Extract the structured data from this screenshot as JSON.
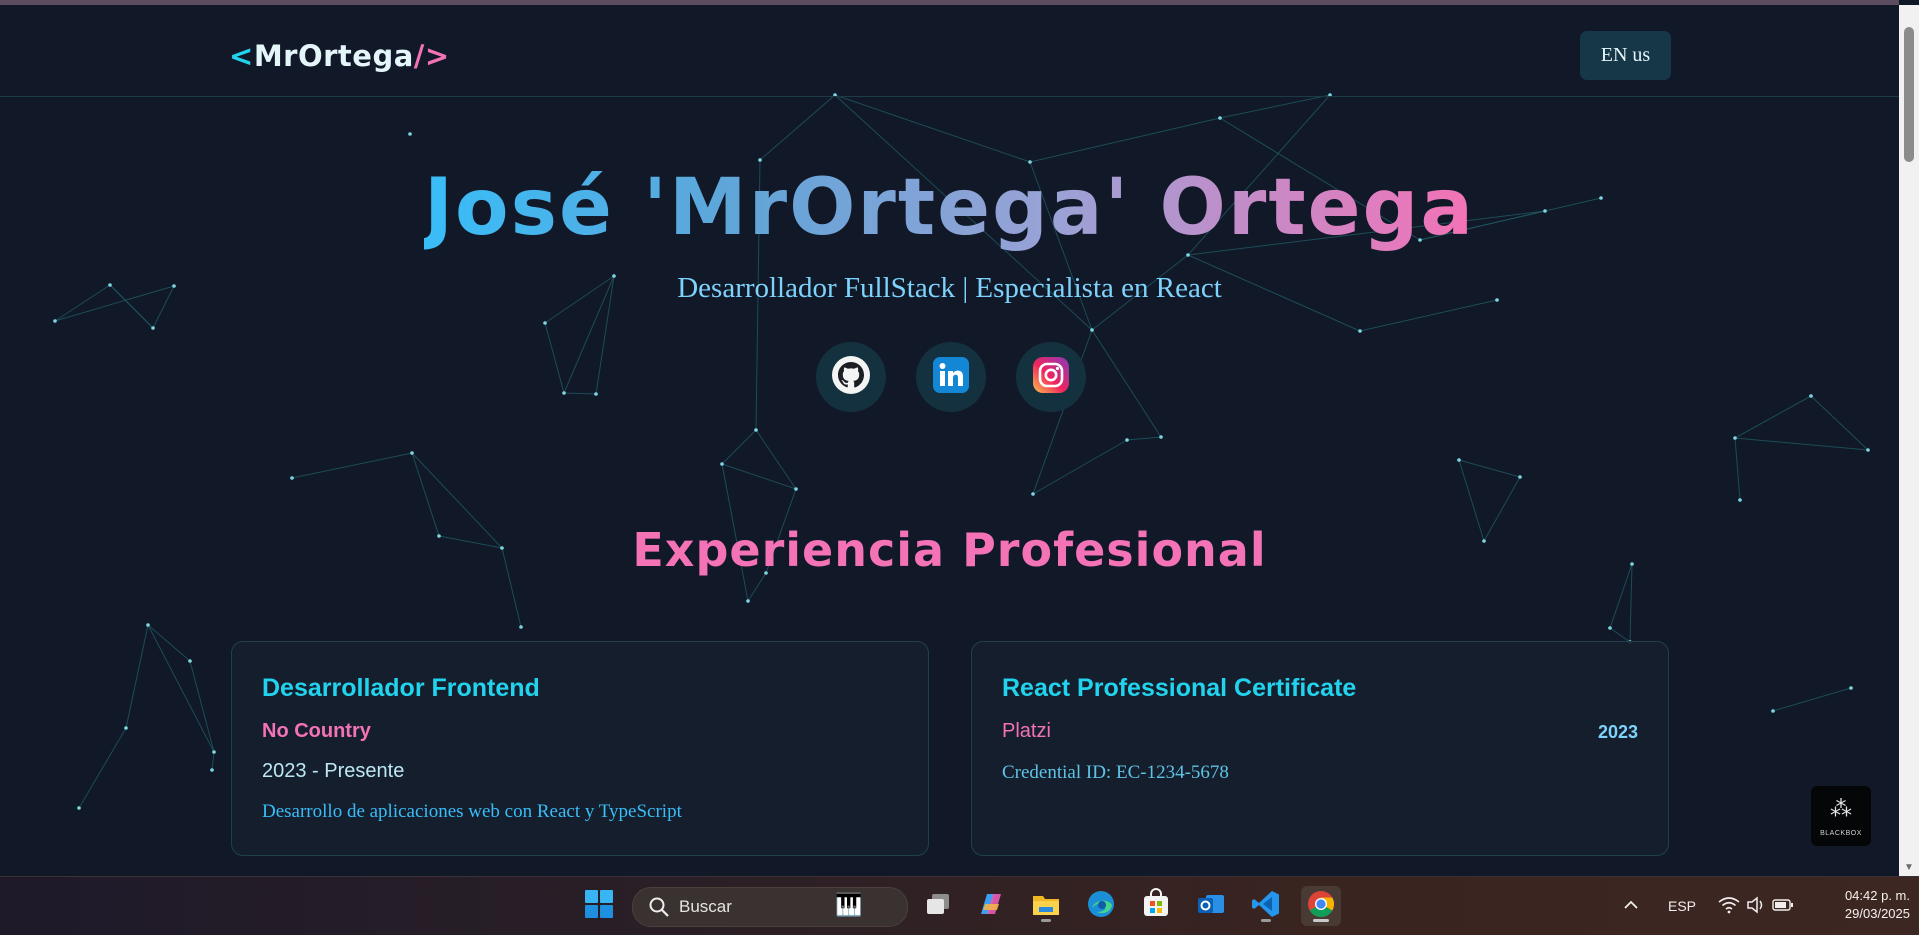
{
  "header": {
    "logo": {
      "open": "<",
      "name": "MrOrtega",
      "close": "/>"
    },
    "lang_button": "EN us"
  },
  "hero": {
    "name": "José 'MrOrtega' Ortega",
    "subtitle": "Desarrollador FullStack | Especialista en React",
    "socials": [
      {
        "icon": "github-icon"
      },
      {
        "icon": "linkedin-icon"
      },
      {
        "icon": "instagram-icon"
      }
    ]
  },
  "experience": {
    "title": "Experiencia Profesional",
    "cards": [
      {
        "title": "Desarrollador Frontend",
        "company": "No Country",
        "period": "2023 - Presente",
        "description": "Desarrollo de aplicaciones web con React y TypeScript"
      },
      {
        "title": "React Professional Certificate",
        "company": "Platzi",
        "year": "2023",
        "credential": "Credential ID: EC-1234-5678"
      }
    ]
  },
  "widget": {
    "label": "BLACKBOX"
  },
  "taskbar": {
    "search_placeholder": "Buscar",
    "language": "ESP",
    "time": "04:42 p. m.",
    "date": "29/03/2025",
    "apps": [
      "start-icon",
      "task-view-icon",
      "copilot-icon",
      "file-explorer-icon",
      "edge-icon",
      "store-icon",
      "outlook-icon",
      "vscode-icon",
      "chrome-icon"
    ]
  },
  "colors": {
    "background": "#111827",
    "accent_cyan": "#22d3ee",
    "accent_pink": "#f472b6"
  }
}
